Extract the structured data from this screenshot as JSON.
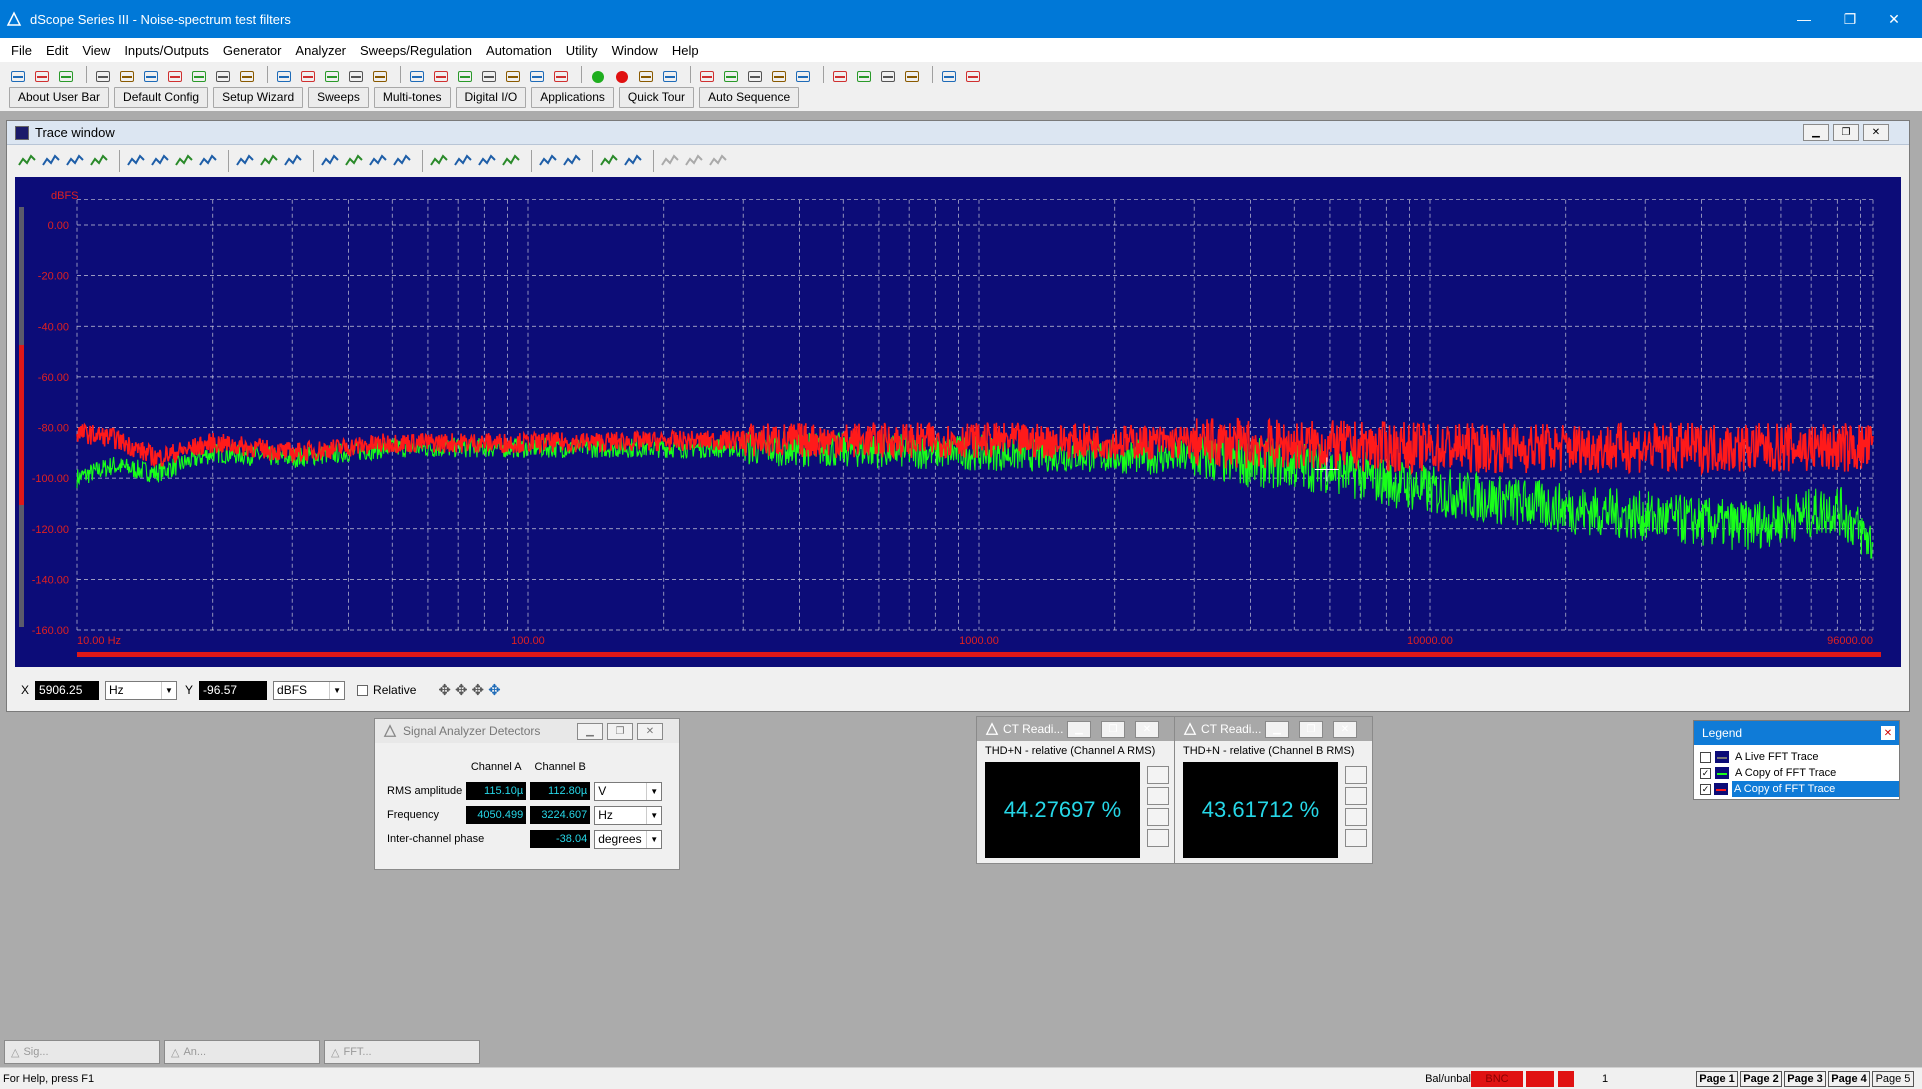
{
  "app": {
    "title": "dScope Series III - Noise-spectrum test filters",
    "min": "—",
    "max": "❐",
    "close": "✕"
  },
  "menu": [
    "File",
    "Edit",
    "View",
    "Inputs/Outputs",
    "Generator",
    "Analyzer",
    "Sweeps/Regulation",
    "Automation",
    "Utility",
    "Window",
    "Help"
  ],
  "toolbar_icons": [
    "open-icon",
    "save-icon",
    "save-all-icon",
    "gen-out-icon",
    "gen-out-2-icon",
    "gen-out-3-icon",
    "gen-out-4-icon",
    "gen-out-5-icon",
    "gen-out-6-icon",
    "gen-out-7-icon",
    "in-icon",
    "in-2-icon",
    "in-3-icon",
    "in-4-icon",
    "stop-icon",
    "analyzer-icon",
    "analyzer-2-icon",
    "analyzer-3-icon",
    "scope-icon",
    "fft-icon",
    "fft-2-icon",
    "fft-3-icon",
    "run-icon",
    "record-icon",
    "sweep-icon",
    "sweep-2-icon",
    "trace-icon",
    "trace-2-icon",
    "trace-3-icon",
    "trace-4-icon",
    "trace-5-icon",
    "chart-icon",
    "loop-icon",
    "loop-2-icon",
    "loop-3-icon",
    "report-icon",
    "report-2-icon"
  ],
  "user_bar": [
    "About User Bar",
    "Default Config",
    "Setup Wizard",
    "Sweeps",
    "Multi-tones",
    "Digital I/O",
    "Applications",
    "Quick Tour",
    "Auto Sequence"
  ],
  "trace_window": {
    "title": "Trace window",
    "toolbar_icons": [
      "trace-a-icon",
      "trace-b-icon",
      "save-trace-icon",
      "copy-trace-icon",
      "chart-grey-icon",
      "chart-grid-icon",
      "table-icon",
      "columns-icon",
      "zoom-x-icon",
      "zoom-y-icon",
      "autoscale-icon",
      "peak-icon",
      "peak-2-icon",
      "peak-3-icon",
      "peak-4-icon",
      "cursor-icon",
      "cursor-2-icon",
      "cursor-3-icon",
      "overlay-icon",
      "marker-icon",
      "marker-2-icon",
      "link-icon",
      "link-2-icon",
      "grey-icon",
      "grey-2-icon",
      "grey-3-icon"
    ]
  },
  "cursor": {
    "x_label": "X",
    "x_value": "5906.25",
    "x_unit": "Hz",
    "y_label": "Y",
    "y_value": "-96.57",
    "y_unit": "dBFS",
    "relative_label": "Relative"
  },
  "chart_data": {
    "type": "line",
    "ylabel": "dBFS",
    "y_ticks": [
      "0.00",
      "-20.00",
      "-40.00",
      "-60.00",
      "-80.00",
      "-100.00",
      "-120.00",
      "-140.00",
      "-160.00"
    ],
    "x_ticks": [
      "10.00 Hz",
      "100.00",
      "1000.00",
      "10000.00",
      "96000.00"
    ],
    "xlim": [
      10,
      96000
    ],
    "ylim": [
      -160,
      10
    ],
    "x_scale": "log",
    "grid": true,
    "series": [
      {
        "color": "#ff1a1a",
        "x": [
          10,
          12,
          15,
          20,
          30,
          50,
          100,
          300,
          1000,
          3000,
          10000,
          30000,
          96000
        ],
        "y": [
          -82,
          -84,
          -92,
          -86,
          -90,
          -86,
          -86,
          -85,
          -85,
          -86,
          -88,
          -88,
          -88
        ]
      },
      {
        "color": "#19ff19",
        "x": [
          10,
          12,
          15,
          20,
          30,
          50,
          100,
          300,
          1000,
          3000,
          5900,
          10000,
          20000,
          50000,
          80000,
          96000
        ],
        "y": [
          -100,
          -95,
          -98,
          -90,
          -92,
          -88,
          -88,
          -88,
          -90,
          -92,
          -96,
          -105,
          -112,
          -119,
          -112,
          -126
        ]
      }
    ]
  },
  "signal_analyzer": {
    "title": "Signal Analyzer Detectors",
    "col_a": "Channel A",
    "col_b": "Channel B",
    "rows": [
      {
        "label": "RMS amplitude",
        "a": "115.10µ",
        "b": "112.80µ",
        "unit": "V"
      },
      {
        "label": "Frequency",
        "a": "4050.499",
        "b": "3224.607",
        "unit": "Hz"
      },
      {
        "label": "Inter-channel phase",
        "a": "",
        "b": "-38.04",
        "unit": "degrees"
      }
    ]
  },
  "ct_a": {
    "title": "CT Readi...",
    "subtitle": "THD+N - relative (Channel A RMS)",
    "value": "44.27697 %"
  },
  "ct_b": {
    "title": "CT Readi...",
    "subtitle": "THD+N - relative (Channel B RMS)",
    "value": "43.61712 %"
  },
  "legend": {
    "title": "Legend",
    "items": [
      {
        "checked": false,
        "label": "A  Live FFT Trace"
      },
      {
        "checked": true,
        "label": "A  Copy of FFT Trace"
      },
      {
        "checked": true,
        "label": "A  Copy of FFT Trace"
      }
    ]
  },
  "minimized": [
    "Sig...",
    "An...",
    "FFT..."
  ],
  "status": {
    "help": "For Help, press F1",
    "bal": "Bal/unbal",
    "bnc": "BNC",
    "count": "1",
    "pages": [
      "Page 1",
      "Page 2",
      "Page 3",
      "Page 4",
      "Page 5"
    ]
  }
}
